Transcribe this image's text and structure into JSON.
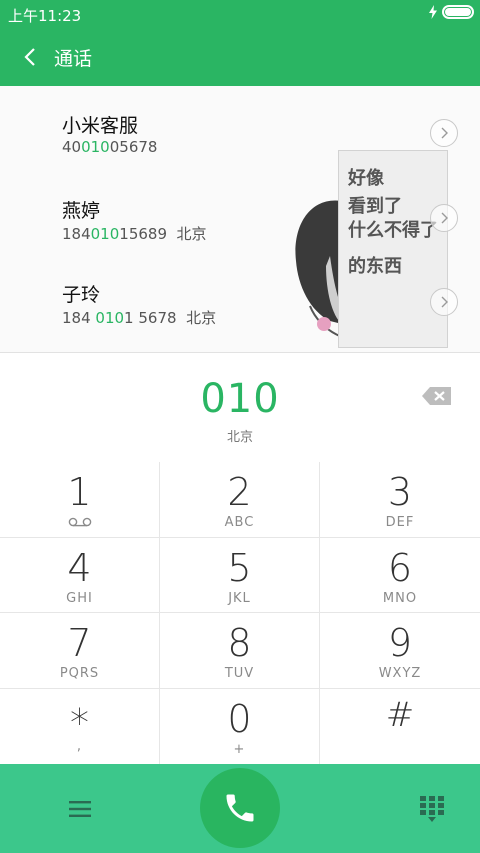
{
  "status_bar": {
    "time": "上午11:23"
  },
  "header": {
    "title": "通话"
  },
  "contacts": [
    {
      "name": "小米客服",
      "number_before": "40",
      "number_match": "010",
      "number_after": "05678",
      "location": ""
    },
    {
      "name": "燕婷",
      "number_before": "184",
      "number_match": "010",
      "number_after": "15689",
      "location": "北京"
    },
    {
      "name": "子玲",
      "number_before": "184 ",
      "number_match": "010",
      "number_after": "1 5678",
      "location": "北京"
    }
  ],
  "meme": {
    "lines": [
      "好像",
      "看到了",
      "什么不得了",
      "的东西"
    ]
  },
  "dial_entry": {
    "digits": "010",
    "location": "北京"
  },
  "keypad": [
    {
      "digit": "1",
      "letters": ""
    },
    {
      "digit": "2",
      "letters": "ABC"
    },
    {
      "digit": "3",
      "letters": "DEF"
    },
    {
      "digit": "4",
      "letters": "GHI"
    },
    {
      "digit": "5",
      "letters": "JKL"
    },
    {
      "digit": "6",
      "letters": "MNO"
    },
    {
      "digit": "7",
      "letters": "PQRS"
    },
    {
      "digit": "8",
      "letters": "TUV"
    },
    {
      "digit": "9",
      "letters": "WXYZ"
    },
    {
      "digit": "*",
      "letters": ","
    },
    {
      "digit": "0",
      "letters": "+"
    },
    {
      "digit": "#",
      "letters": ""
    }
  ],
  "icons": {
    "back": "chevron-left-icon",
    "charging": "lightning-icon",
    "battery": "battery-icon",
    "detail": "chevron-right-icon",
    "backspace": "backspace-icon",
    "voicemail": "voicemail-icon",
    "menu": "menu-icon",
    "call": "phone-icon",
    "keypad_toggle": "dialpad-icon"
  },
  "colors": {
    "primary": "#2ab563",
    "bottom_bar": "#3cc78b",
    "call_button": "#29b560"
  }
}
